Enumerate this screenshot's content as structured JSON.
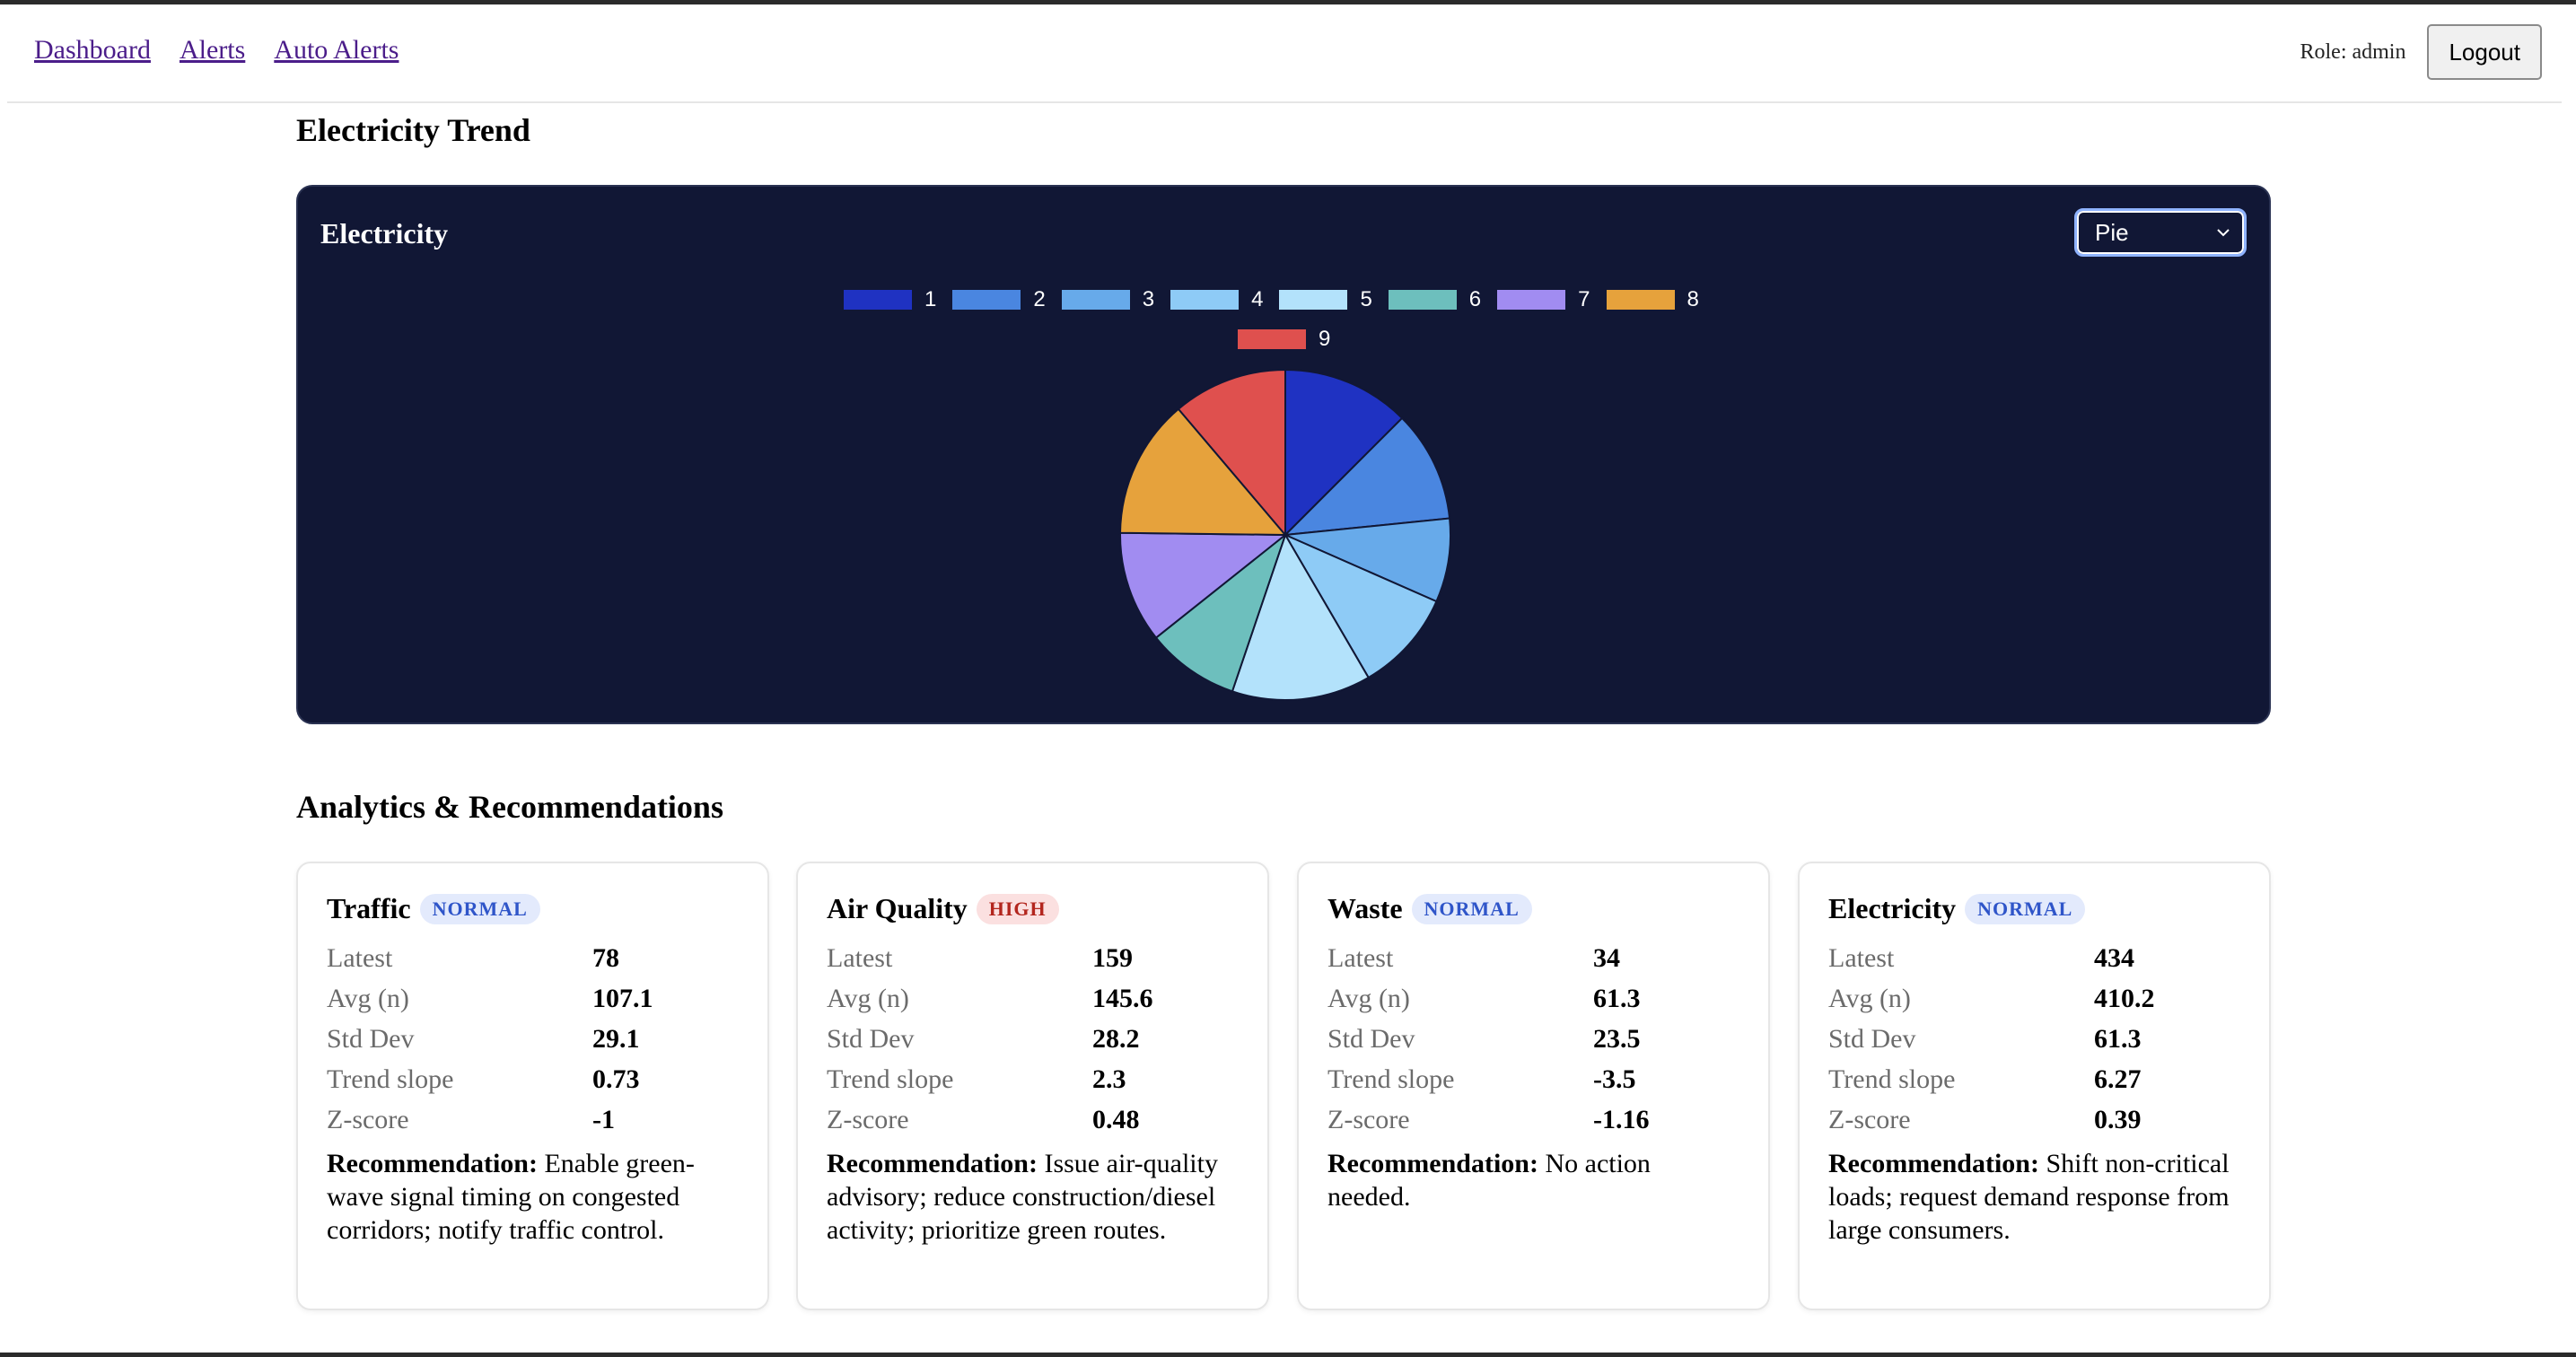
{
  "nav": {
    "links": [
      "Dashboard",
      "Alerts",
      "Auto Alerts"
    ],
    "role": "Role: admin",
    "logout": "Logout"
  },
  "trend": {
    "heading": "Electricity Trend",
    "chart_title": "Electricity",
    "chart_type_selected": "Pie"
  },
  "chart_data": {
    "type": "pie",
    "title": "Electricity",
    "categories": [
      "1",
      "2",
      "3",
      "4",
      "5",
      "6",
      "7",
      "8",
      "9"
    ],
    "values": [
      12.5,
      10.9,
      8.2,
      10.0,
      13.6,
      9.1,
      10.9,
      13.6,
      11.2
    ],
    "colors": [
      "#1f32c2",
      "#4a86e0",
      "#67aaea",
      "#8ecbf6",
      "#b3e2fb",
      "#6dbfbd",
      "#a18cf1",
      "#e6a23c",
      "#df504e"
    ],
    "legend_position": "top",
    "slice_border": "#111735"
  },
  "analytics": {
    "heading": "Analytics & Recommendations",
    "stat_labels": [
      "Latest",
      "Avg (n)",
      "Std Dev",
      "Trend slope",
      "Z-score"
    ],
    "rec_label": "Recommendation:",
    "cards": [
      {
        "title": "Traffic",
        "status": "NORMAL",
        "values": [
          "78",
          "107.1",
          "29.1",
          "0.73",
          "-1"
        ],
        "recommendation": "Enable green-wave signal timing on congested corridors; notify traffic control."
      },
      {
        "title": "Air Quality",
        "status": "HIGH",
        "values": [
          "159",
          "145.6",
          "28.2",
          "2.3",
          "0.48"
        ],
        "recommendation": "Issue air-quality advisory; reduce construction/diesel activity; prioritize green routes."
      },
      {
        "title": "Waste",
        "status": "NORMAL",
        "values": [
          "34",
          "61.3",
          "23.5",
          "-3.5",
          "-1.16"
        ],
        "recommendation": "No action needed."
      },
      {
        "title": "Electricity",
        "status": "NORMAL",
        "values": [
          "434",
          "410.2",
          "61.3",
          "6.27",
          "0.39"
        ],
        "recommendation": "Shift non-critical loads; request demand response from large consumers."
      }
    ]
  }
}
